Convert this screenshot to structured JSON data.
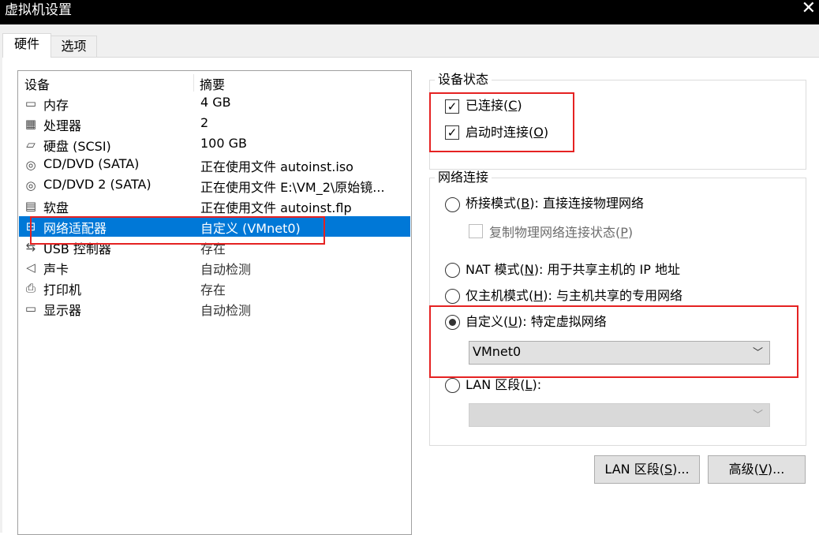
{
  "window": {
    "title": "虚拟机设置"
  },
  "tabs": [
    {
      "label": "硬件"
    },
    {
      "label": "选项"
    }
  ],
  "device_list": {
    "headers": {
      "device": "设备",
      "summary": "摘要"
    },
    "rows": [
      {
        "icon": "memory-icon",
        "name": "内存",
        "summary": "4 GB"
      },
      {
        "icon": "cpu-icon",
        "name": "处理器",
        "summary": "2"
      },
      {
        "icon": "harddisk-icon",
        "name": "硬盘 (SCSI)",
        "summary": "100 GB"
      },
      {
        "icon": "cd-icon",
        "name": "CD/DVD (SATA)",
        "summary": "正在使用文件 autoinst.iso"
      },
      {
        "icon": "cd-icon",
        "name": "CD/DVD 2 (SATA)",
        "summary": "正在使用文件 E:\\VM_2\\原始镜..."
      },
      {
        "icon": "floppy-icon",
        "name": "软盘",
        "summary": "正在使用文件 autoinst.flp"
      },
      {
        "icon": "network-adapter-icon",
        "name": "网络适配器",
        "summary": "自定义 (VMnet0)"
      },
      {
        "icon": "usb-icon",
        "name": "USB 控制器",
        "summary": "存在"
      },
      {
        "icon": "sound-icon",
        "name": "声卡",
        "summary": "自动检测"
      },
      {
        "icon": "printer-icon",
        "name": "打印机",
        "summary": "存在"
      },
      {
        "icon": "display-icon",
        "name": "显示器",
        "summary": "自动检测"
      }
    ],
    "selected_index": 6
  },
  "device_status": {
    "title": "设备状态",
    "connected": {
      "label_pre": "已连接(",
      "key": "C",
      "label_post": ")",
      "checked": true
    },
    "connect_at_power_on": {
      "label_pre": "启动时连接(",
      "key": "O",
      "label_post": ")",
      "checked": true
    }
  },
  "network_connection": {
    "title": "网络连接",
    "bridged": {
      "label_pre": "桥接模式(",
      "key": "B",
      "label_post": "): 直接连接物理网络",
      "selected": false
    },
    "replicate": {
      "label_pre": "复制物理网络连接状态(",
      "key": "P",
      "label_post": ")",
      "checked": false,
      "enabled": false
    },
    "nat": {
      "label_pre": "NAT 模式(",
      "key": "N",
      "label_post": "): 用于共享主机的 IP 地址",
      "selected": false
    },
    "host_only": {
      "label_pre": "仅主机模式(",
      "key": "H",
      "label_post": "): 与主机共享的专用网络",
      "selected": false
    },
    "custom": {
      "label_pre": "自定义(",
      "key": "U",
      "label_post": "): 特定虚拟网络",
      "selected": true
    },
    "custom_select": {
      "value": "VMnet0"
    },
    "lan_segment": {
      "label_pre": "LAN 区段(",
      "key": "L",
      "label_post": "):",
      "selected": false
    },
    "lan_select": {
      "value": ""
    }
  },
  "buttons": {
    "lan_segments": {
      "label_pre": "LAN 区段(",
      "key": "S",
      "label_post": ")..."
    },
    "advanced": {
      "label_pre": "高级(",
      "key": "V",
      "label_post": ")..."
    }
  },
  "colors": {
    "selection": "#0078d7",
    "highlight_box": "#e52222"
  }
}
